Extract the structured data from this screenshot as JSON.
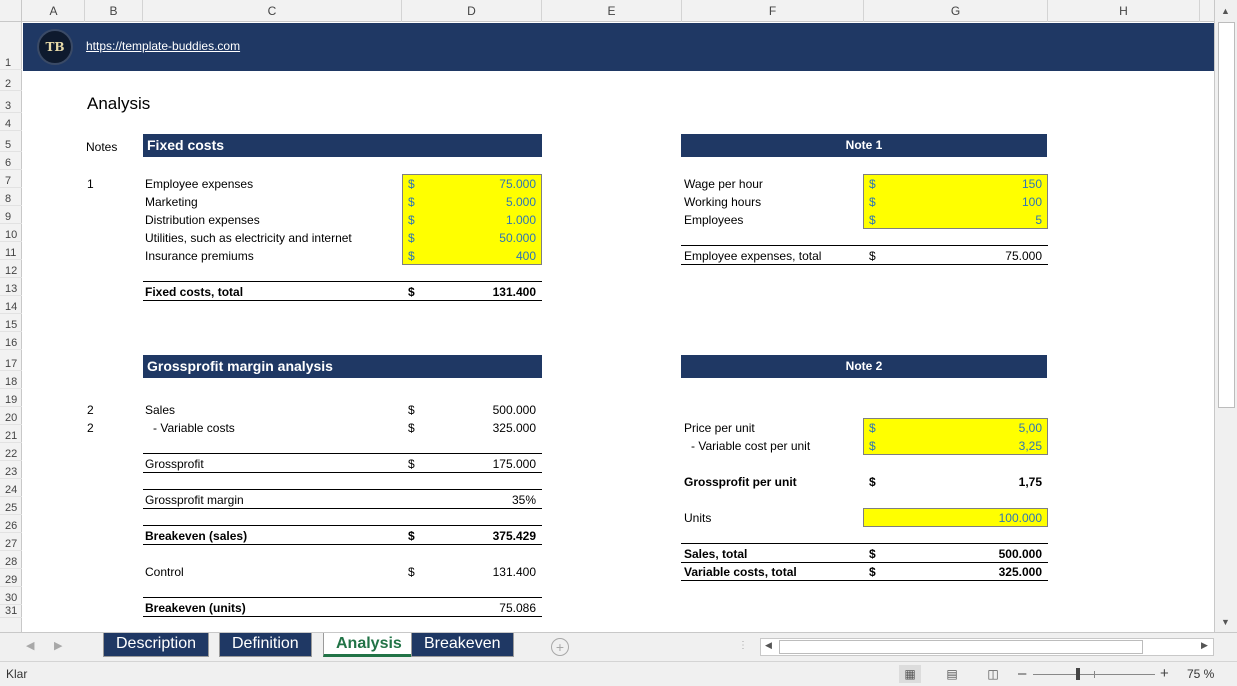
{
  "columns": [
    "A",
    "B",
    "C",
    "D",
    "E",
    "F",
    "G",
    "H"
  ],
  "rows": [
    "1",
    "2",
    "3",
    "4",
    "5",
    "6",
    "7",
    "8",
    "9",
    "10",
    "11",
    "12",
    "13",
    "14",
    "15",
    "16",
    "17",
    "18",
    "19",
    "20",
    "21",
    "22",
    "23",
    "24",
    "25",
    "26",
    "27",
    "28",
    "29",
    "30",
    "31"
  ],
  "banner": {
    "logo": "TB",
    "link": "https://template-buddies.com"
  },
  "title": "Analysis",
  "notes_label": "Notes",
  "currency": "$",
  "fixed_costs": {
    "header": "Fixed costs",
    "note": "1",
    "items": [
      {
        "label": "Employee expenses",
        "value": "75.000"
      },
      {
        "label": "Marketing",
        "value": "5.000"
      },
      {
        "label": "Distribution expenses",
        "value": "1.000"
      },
      {
        "label": "Utilities, such as electricity and internet",
        "value": "50.000"
      },
      {
        "label": "Insurance premiums",
        "value": "400"
      }
    ],
    "total_label": "Fixed costs, total",
    "total_value": "131.400"
  },
  "note1": {
    "header": "Note 1",
    "items": [
      {
        "label": "Wage per hour",
        "value": "150"
      },
      {
        "label": "Working hours",
        "value": "100"
      },
      {
        "label": "Employees",
        "value": "5"
      }
    ],
    "total_label": "Employee expenses, total",
    "total_value": "75.000"
  },
  "gp": {
    "header": "Grossprofit margin analysis",
    "sales_note": "2",
    "sales_label": "Sales",
    "sales_value": "500.000",
    "var_note": "2",
    "var_label": "- Variable costs",
    "var_value": "325.000",
    "gross_label": "Grossprofit",
    "gross_value": "175.000",
    "margin_label": "Grossprofit margin",
    "margin_value": "35%",
    "be_sales_label": "Breakeven (sales)",
    "be_sales_value": "375.429",
    "control_label": "Control",
    "control_value": "131.400",
    "be_units_label": "Breakeven (units)",
    "be_units_value": "75.086"
  },
  "note2": {
    "header": "Note 2",
    "price_label": "Price per unit",
    "price_value": "5,00",
    "varcost_label": "- Variable cost per unit",
    "varcost_value": "3,25",
    "gpu_label": "Grossprofit per unit",
    "gpu_value": "1,75",
    "units_label": "Units",
    "units_value": "100.000",
    "sales_total_label": "Sales, total",
    "sales_total_value": "500.000",
    "var_total_label": "Variable costs, total",
    "var_total_value": "325.000"
  },
  "tabs": [
    "Description",
    "Definition",
    "Analysis",
    "Breakeven"
  ],
  "active_tab": "Analysis",
  "status": {
    "ready": "Klar",
    "zoom": "75 %"
  },
  "colors": {
    "navy": "#1f3864",
    "input_yellow": "#ffff00",
    "currency_blue": "#2e75b6",
    "active_tab_green": "#217346"
  }
}
